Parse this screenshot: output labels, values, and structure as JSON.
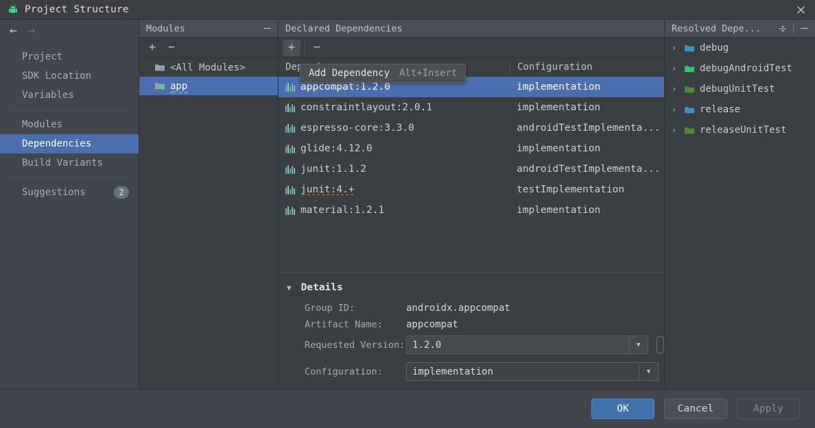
{
  "window": {
    "title": "Project Structure",
    "app_icon": "android-icon",
    "close_icon": "close-icon"
  },
  "nav": {
    "back_icon": "arrow-left-icon",
    "forward_icon": "arrow-right-icon"
  },
  "sidebar": {
    "groups": [
      {
        "items": [
          {
            "label": "Project",
            "selected": false
          },
          {
            "label": "SDK Location",
            "selected": false
          },
          {
            "label": "Variables",
            "selected": false
          }
        ]
      },
      {
        "items": [
          {
            "label": "Modules",
            "selected": false
          },
          {
            "label": "Dependencies",
            "selected": true
          },
          {
            "label": "Build Variants",
            "selected": false
          }
        ]
      },
      {
        "items": [
          {
            "label": "Suggestions",
            "selected": false,
            "badge": "2"
          }
        ]
      }
    ]
  },
  "modules_panel": {
    "header": "Modules",
    "minimize_icon": "minimize-icon",
    "toolbar": {
      "add": "+",
      "remove": "−"
    },
    "items": [
      {
        "label": "<All Modules>",
        "icon": "folder-modules-icon",
        "selected": false,
        "wavy": false
      },
      {
        "label": "app",
        "icon": "folder-app-icon",
        "selected": true,
        "wavy": true
      }
    ]
  },
  "declared_panel": {
    "header": "Declared Dependencies",
    "toolbar": {
      "add": "+",
      "remove": "−"
    },
    "tooltip": {
      "label": "Add Dependency",
      "shortcut": "Alt+Insert"
    },
    "columns": [
      "Dependency",
      "Configuration"
    ],
    "rows": [
      {
        "name": "appcompat:1.2.0",
        "configuration": "implementation",
        "selected": true,
        "warning": false
      },
      {
        "name": "constraintlayout:2.0.1",
        "configuration": "implementation",
        "selected": false,
        "warning": false
      },
      {
        "name": "espresso-core:3.3.0",
        "configuration": "androidTestImplementa...",
        "selected": false,
        "warning": false
      },
      {
        "name": "glide:4.12.0",
        "configuration": "implementation",
        "selected": false,
        "warning": false
      },
      {
        "name": "junit:1.1.2",
        "configuration": "androidTestImplementa...",
        "selected": false,
        "warning": false
      },
      {
        "name": "junit:4.+",
        "configuration": "testImplementation",
        "selected": false,
        "warning": true
      },
      {
        "name": "material:1.2.1",
        "configuration": "implementation",
        "selected": false,
        "warning": false
      }
    ]
  },
  "details": {
    "title": "Details",
    "collapse_icon": "caret-down-icon",
    "group_id_label": "Group ID:",
    "group_id_value": "androidx.appcompat",
    "artifact_label": "Artifact Name:",
    "artifact_value": "appcompat",
    "version_label": "Requested Version:",
    "version_value": "1.2.0",
    "configuration_label": "Configuration:",
    "configuration_value": "implementation"
  },
  "resolved_panel": {
    "header": "Resolved Depe...",
    "collapse_all_icon": "collapse-all-icon",
    "minimize_icon": "minimize-icon",
    "items": [
      {
        "label": "debug",
        "icon": "folder-blue-icon"
      },
      {
        "label": "debugAndroidTest",
        "icon": "folder-green-icon"
      },
      {
        "label": "debugUnitTest",
        "icon": "folder-olive-icon"
      },
      {
        "label": "release",
        "icon": "folder-blue-icon"
      },
      {
        "label": "releaseUnitTest",
        "icon": "folder-olive-icon"
      }
    ]
  },
  "footer": {
    "ok": "OK",
    "cancel": "Cancel",
    "apply": "Apply"
  },
  "colors": {
    "selection": "#4b6eaf",
    "primary_button": "#4271ae",
    "panel_header": "#4a4f57",
    "sidebar_bg": "#41454e",
    "content_bg": "#3c3f41",
    "warning": "#c98b3a"
  }
}
